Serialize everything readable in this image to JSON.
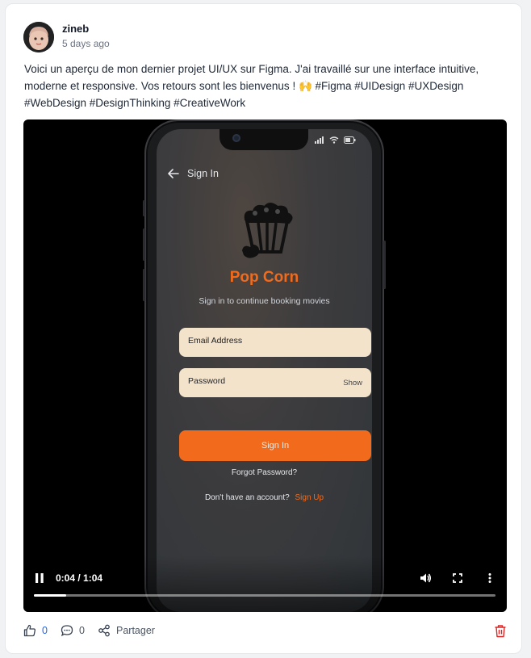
{
  "post": {
    "author": "zineb",
    "timestamp": "5 days ago",
    "text": "Voici un aperçu de mon dernier projet UI/UX sur Figma. J'ai travaillé sur une interface intuitive, moderne et responsive. Vos retours sont les bienvenus ! 🙌 #Figma #UIDesign #UXDesign #WebDesign #DesignThinking #CreativeWork"
  },
  "video": {
    "app": {
      "screen_title": "Sign In",
      "brand": "Pop Corn",
      "subtitle": "Sign in to continue booking movies",
      "email_label": "Email Address",
      "password_label": "Password",
      "show_label": "Show",
      "signin_button": "Sign In",
      "forgot_link": "Forgot Password?",
      "no_account": "Don't have an account?",
      "signup_link": "Sign Up"
    },
    "time": "0:04 / 1:04",
    "progress_fraction": 0.07
  },
  "actions": {
    "like_count": "0",
    "comment_count": "0",
    "share_label": "Partager"
  },
  "colors": {
    "accent": "#f26a1b",
    "like": "#2563eb",
    "delete": "#dc2626"
  },
  "icons": [
    "thumbs-up-icon",
    "comment-icon",
    "share-icon",
    "trash-icon",
    "pause-icon",
    "volume-icon",
    "fullscreen-icon",
    "more-vertical-icon",
    "back-arrow-icon",
    "popcorn-icon"
  ]
}
